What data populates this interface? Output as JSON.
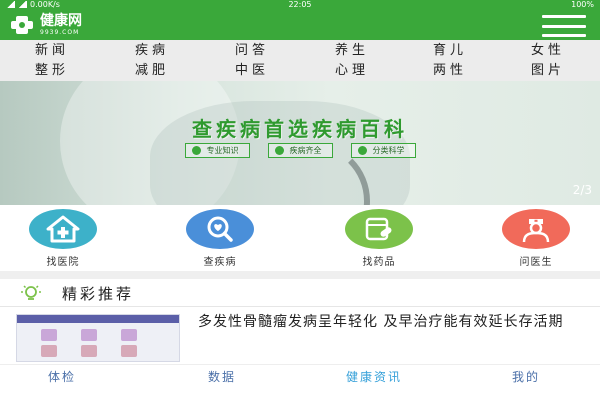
{
  "status_bar": {
    "network": "0.00K/s",
    "time": "22:05",
    "battery": "100%"
  },
  "header": {
    "logo_title": "健康网",
    "logo_subtitle": "9939.COM"
  },
  "categories": [
    [
      "新闻",
      "疾病",
      "问答",
      "养生",
      "育儿",
      "女性"
    ],
    [
      "整形",
      "减肥",
      "中医",
      "心理",
      "两性",
      "图片"
    ]
  ],
  "banner": {
    "title": "查疾病首选疾病百科",
    "features": [
      "专业知识",
      "疾病齐全",
      "分类科学"
    ],
    "page_indicator": "2/3"
  },
  "quick_actions": [
    {
      "label": "找医院",
      "color": "#3db1c9",
      "icon": "hospital-icon"
    },
    {
      "label": "查疾病",
      "color": "#4a8fd9",
      "icon": "search-heart-icon"
    },
    {
      "label": "找药品",
      "color": "#7cc24a",
      "icon": "pill-icon"
    },
    {
      "label": "问医生",
      "color": "#f16a5a",
      "icon": "doctor-icon"
    }
  ],
  "featured": {
    "title": "精彩推荐",
    "articles": [
      {
        "headline": "多发性骨髓瘤发病呈年轻化 及早治疗能有效延长存活期"
      }
    ]
  },
  "tabs": [
    {
      "label": "体检",
      "active": false
    },
    {
      "label": "数据",
      "active": false
    },
    {
      "label": "健康资讯",
      "active": true
    },
    {
      "label": "我的",
      "active": false
    }
  ],
  "colors": {
    "brand_green": "#3aa83a",
    "active_tab": "#35a0d9"
  }
}
